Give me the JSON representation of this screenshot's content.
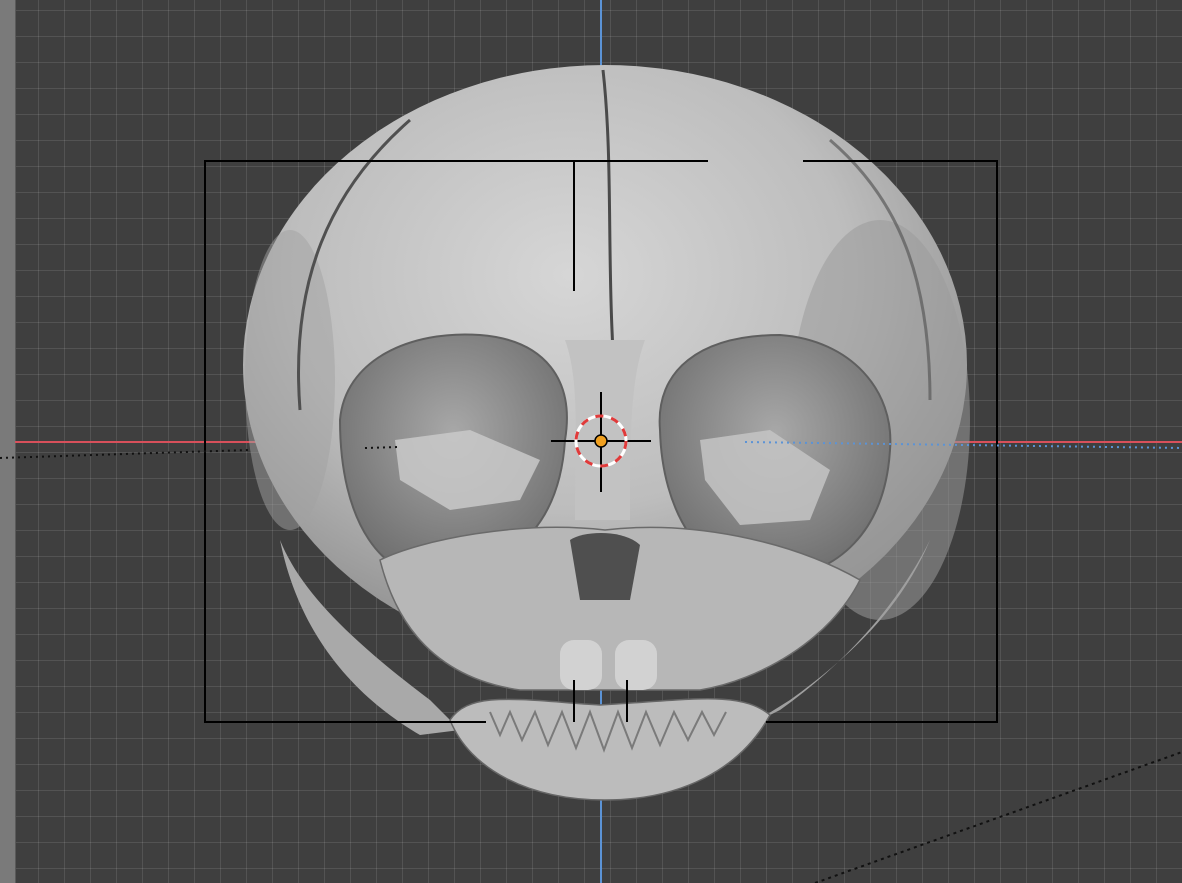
{
  "viewport": {
    "view": "front-orthographic",
    "background_color": "#3f3f3f",
    "grid_color": "#595959",
    "x_axis_color": "#d8505b",
    "z_axis_color": "#5b93d6"
  },
  "model": {
    "name": "infant-skull",
    "surface_color": "#c7c7c7",
    "shadow_color": "#8d8d8d"
  },
  "camera_frame": {
    "color": "#000000"
  },
  "cursor_3d": {
    "ring_color_a": "#e03a3a",
    "ring_color_b": "#ffffff",
    "origin_color": "#f0a020"
  }
}
